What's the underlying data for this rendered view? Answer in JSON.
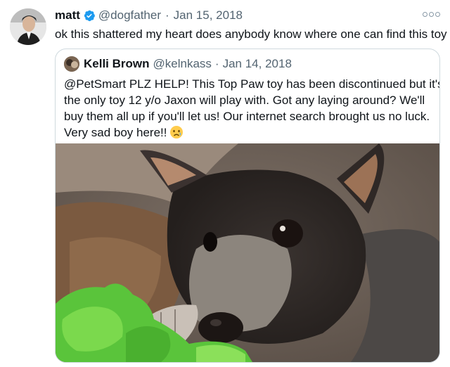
{
  "author": {
    "name": "matt",
    "handle": "@dogfather",
    "separator": "·",
    "date": "Jan 15, 2018"
  },
  "tweet": {
    "text": "ok this shattered my heart does anybody know where one can find this toy"
  },
  "quoted": {
    "name": "Kelli Brown",
    "handle": "@kelnkass",
    "separator": "·",
    "date": "Jan 14, 2018",
    "lines": [
      "@PetSmart PLZ HELP! This Top Paw toy has been discontinued but it's",
      "the only toy 12 y/o Jaxon will play with. Got any laying around? We'll",
      "buy them all up if you'll let us! Our internet search brought us no luck.",
      "Very sad boy here!!"
    ],
    "emoji": "crying-face"
  },
  "colors": {
    "verified_blue": "#1d9bf0",
    "secondary_text": "#536471",
    "border": "#cfd9de"
  },
  "icons": {
    "verified": "verified-badge-icon",
    "more": "more-options-icon"
  }
}
